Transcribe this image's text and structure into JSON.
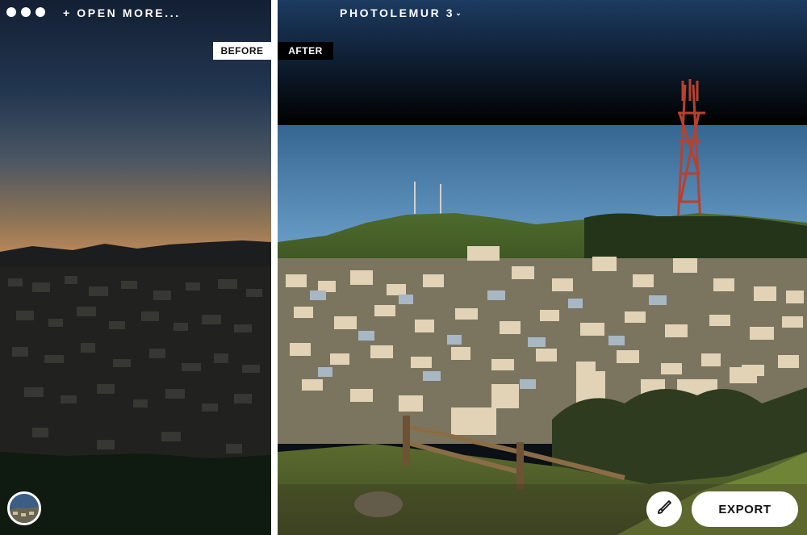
{
  "window": {
    "title": "PHOTOLEMUR 3",
    "title_caret": "⌄",
    "open_more": "+ OPEN MORE..."
  },
  "compare": {
    "before_label": "BEFORE",
    "after_label": "AFTER"
  },
  "footer": {
    "export_label": "EXPORT",
    "brush_icon": "brush-icon",
    "thumbnail": "image-thumbnail"
  },
  "colors": {
    "accent": "#ffffff",
    "after_sky_top": "#1d3f66",
    "after_sky_bottom": "#4d86b4",
    "before_sky_top": "#1a2c44",
    "before_sky_bottom": "#b8875a"
  }
}
